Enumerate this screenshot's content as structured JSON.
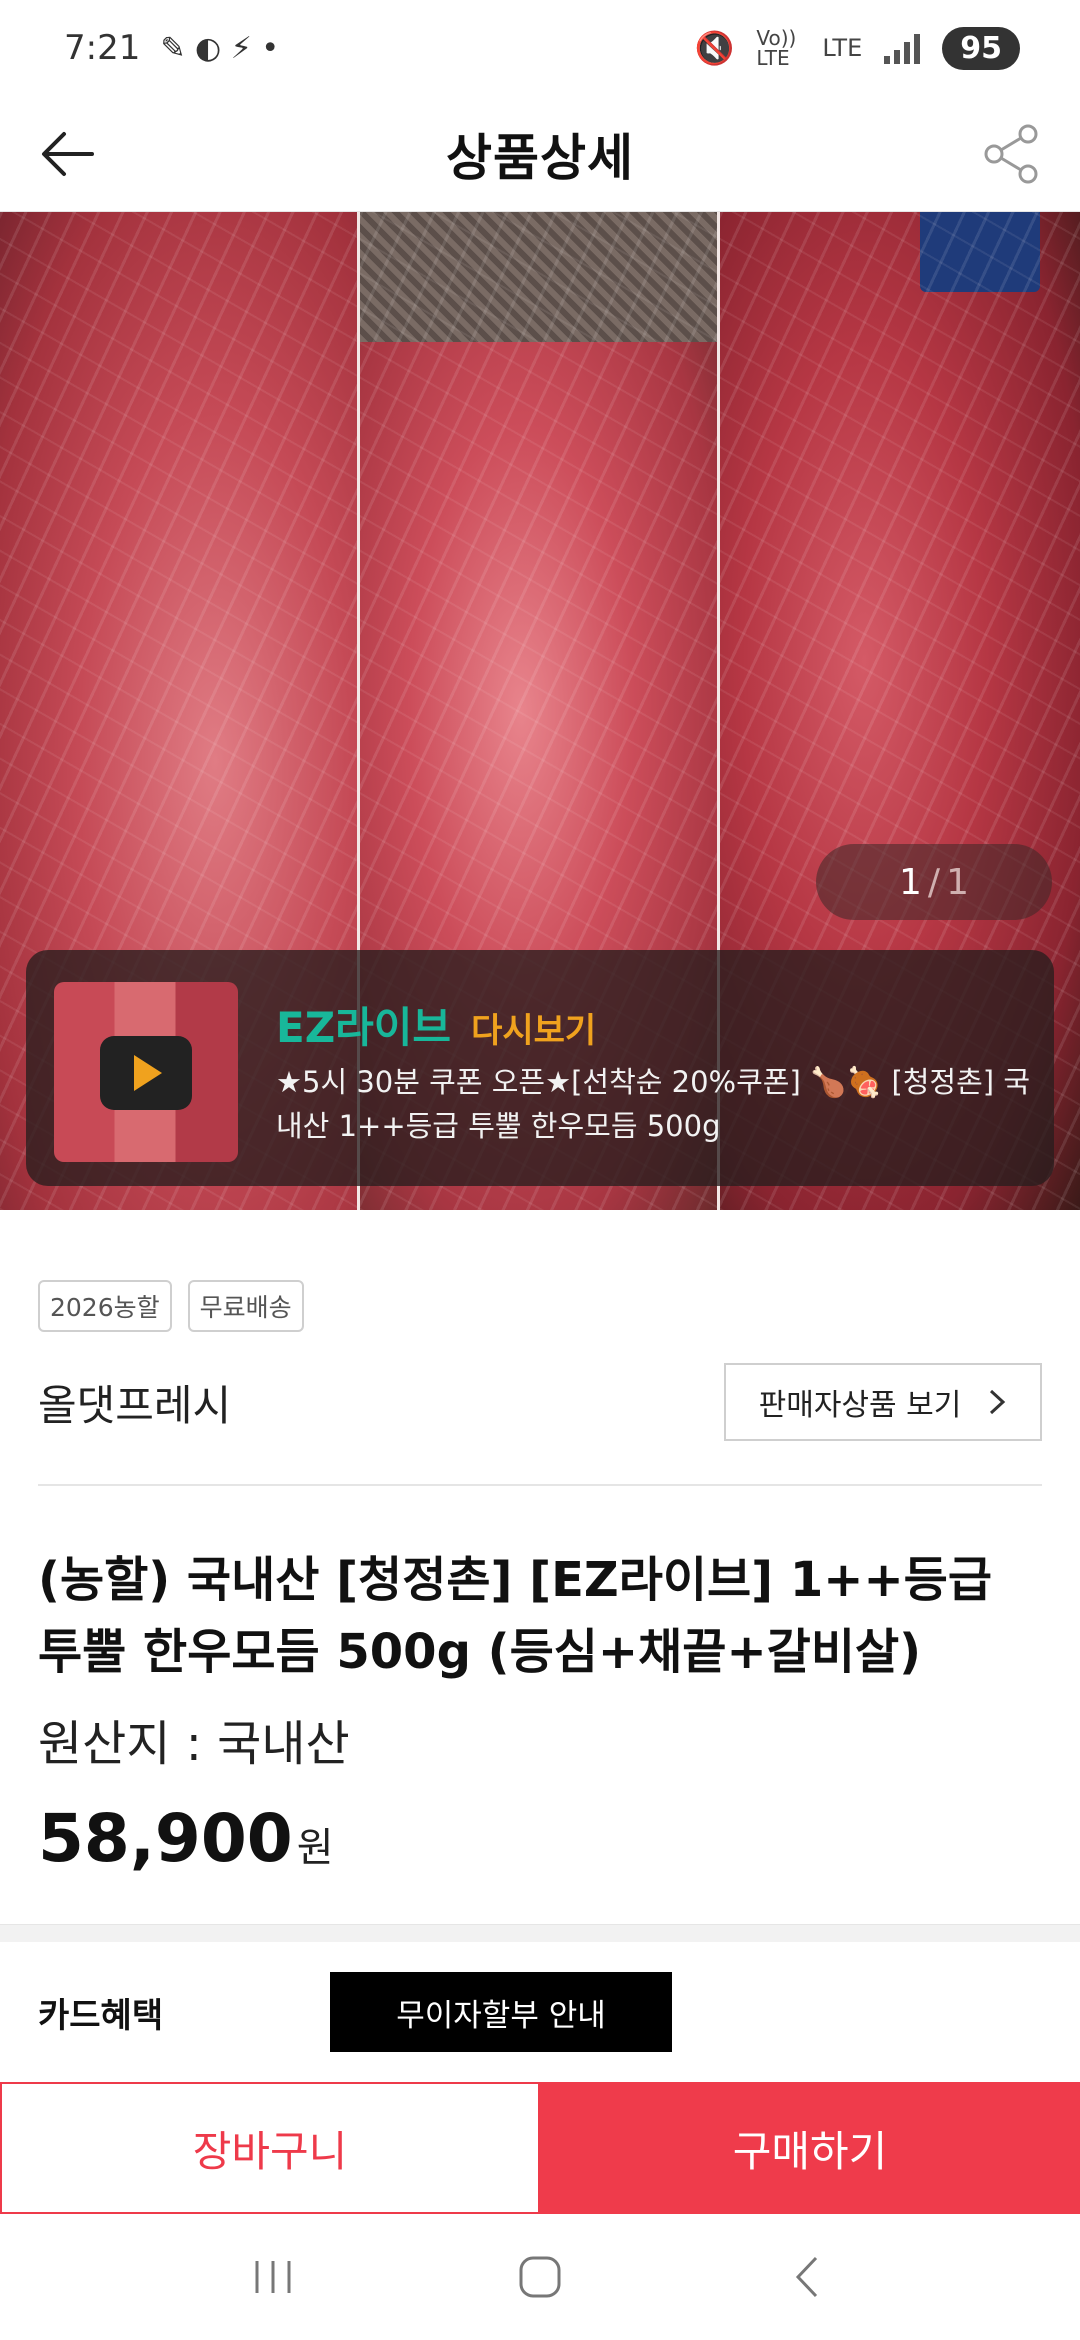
{
  "status_bar": {
    "time": "7:21",
    "volte_label": "Vo)) LTE",
    "lte_label": "LTE",
    "battery": "95"
  },
  "header": {
    "title": "상품상세"
  },
  "hero": {
    "page_current": "1",
    "page_separator": "/",
    "page_total": "1",
    "live": {
      "brand": "EZ라이브",
      "replay": "다시보기",
      "description": "★5시 30분 쿠폰 오픈★[선착순 20%쿠폰] 🍗🍖 [청정촌] 국내산 1++등급 투뿔 한우모듬 500g"
    }
  },
  "tags": [
    "2026농할",
    "무료배송"
  ],
  "seller": {
    "name": "올댓프레시",
    "view_products_label": "판매자상품 보기"
  },
  "product": {
    "title": "(농할) 국내산 [청정촌] [EZ라이브] 1++등급 투뿔 한우모듬 500g (등심+채끝+갈비살)",
    "origin": "원산지 : 국내산",
    "price": "58,900",
    "price_unit": "원"
  },
  "card_benefit": {
    "label": "카드혜택",
    "installment_label": "무이자할부 안내"
  },
  "actions": {
    "cart_label": "장바구니",
    "buy_label": "구매하기"
  },
  "colors": {
    "accent_red": "#ef3b4b",
    "live_green": "#18b79a",
    "replay_orange": "#f0a21e"
  }
}
